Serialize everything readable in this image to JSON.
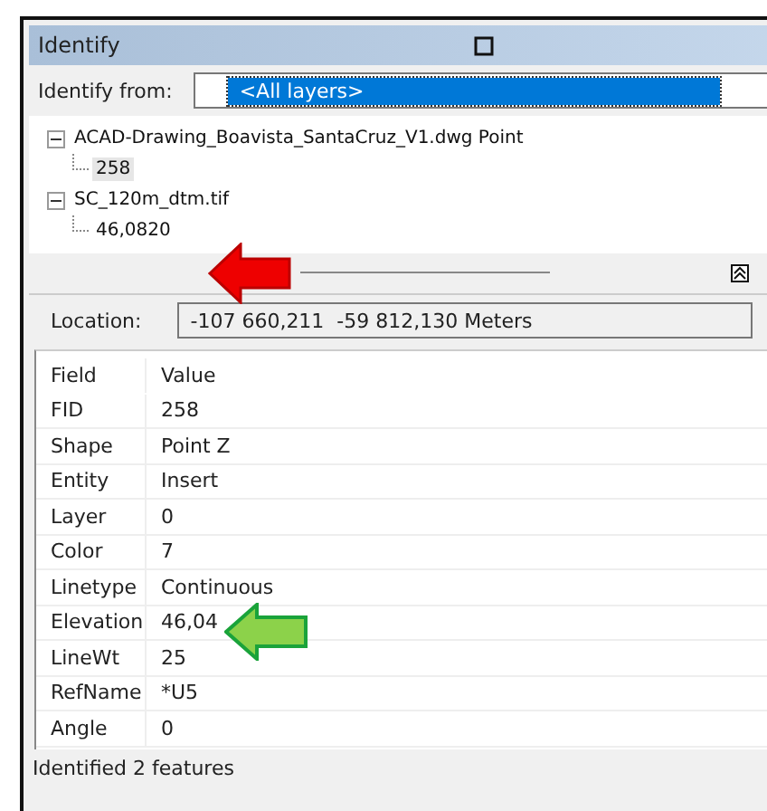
{
  "window": {
    "title": "Identify"
  },
  "identify_from": {
    "label": "Identify from:",
    "value": "<All layers>"
  },
  "tree": [
    {
      "label": "ACAD-Drawing_Boavista_SantaCruz_V1.dwg Point",
      "expanded": true,
      "children": [
        {
          "label": "258",
          "selected": true
        }
      ]
    },
    {
      "label": "SC_120m_dtm.tif",
      "expanded": true,
      "children": [
        {
          "label": "46,0820",
          "selected": false
        }
      ]
    }
  ],
  "location": {
    "label": "Location:",
    "value": "-107 660,211  -59 812,130 Meters"
  },
  "table": {
    "columns": [
      "Field",
      "Value"
    ],
    "rows": [
      [
        "FID",
        "258"
      ],
      [
        "Shape",
        "Point Z"
      ],
      [
        "Entity",
        "Insert"
      ],
      [
        "Layer",
        "0"
      ],
      [
        "Color",
        "7"
      ],
      [
        "Linetype",
        "Continuous"
      ],
      [
        "Elevation",
        "46,04"
      ],
      [
        "LineWt",
        "25"
      ],
      [
        "RefName",
        "*U5"
      ],
      [
        "Angle",
        "0"
      ]
    ]
  },
  "status_bar": "Identified 2 features"
}
